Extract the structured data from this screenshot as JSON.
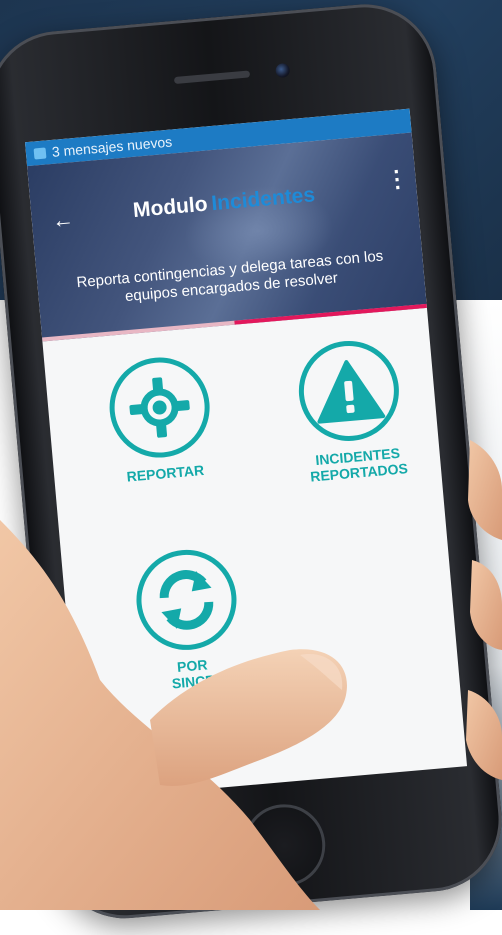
{
  "status_bar": {
    "notification_text": "3 mensajes nuevos"
  },
  "header": {
    "title_prefix": "Modulo",
    "title_accent": "Incidentes",
    "subtitle": "Reporta contingencias y delega tareas con los equipos encargados de resolver"
  },
  "tiles": [
    {
      "label": "REPORTAR",
      "icon": "crosshair-icon"
    },
    {
      "label": "INCIDENTES REPORTADOS",
      "icon": "warning-icon"
    },
    {
      "label": "POR SINCR",
      "icon": "sync-icon"
    }
  ],
  "colors": {
    "accent_teal": "#14a9a9",
    "status_bar": "#1d7bc4",
    "tab_indicator": "#e2185c",
    "title_accent": "#1e8bd8"
  }
}
